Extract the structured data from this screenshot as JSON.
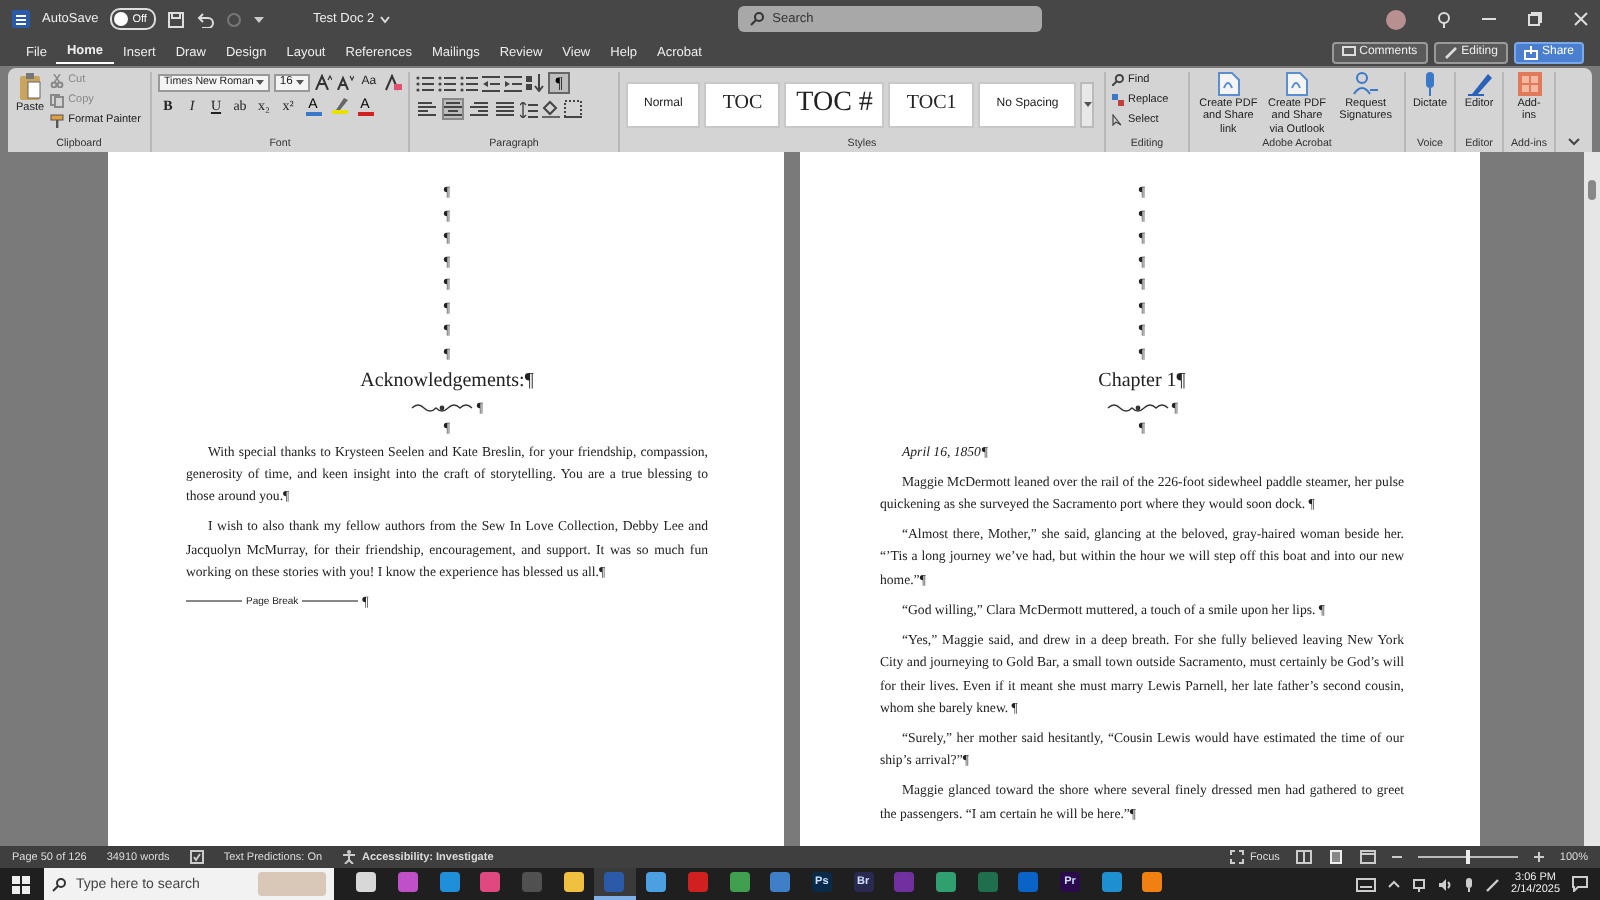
{
  "title_bar": {
    "autosave_label": "AutoSave",
    "autosave": {
      "on": false,
      "label": "Off"
    },
    "document_title": "Test Doc 2",
    "search": {
      "placeholder": "Search"
    }
  },
  "menu_tabs": [
    {
      "label": "File",
      "selected": false
    },
    {
      "label": "Home",
      "selected": true
    },
    {
      "label": "Insert",
      "selected": false
    },
    {
      "label": "Draw",
      "selected": false
    },
    {
      "label": "Design",
      "selected": false
    },
    {
      "label": "Layout",
      "selected": false
    },
    {
      "label": "References",
      "selected": false
    },
    {
      "label": "Mailings",
      "selected": false
    },
    {
      "label": "Review",
      "selected": false
    },
    {
      "label": "View",
      "selected": false
    },
    {
      "label": "Help",
      "selected": false
    },
    {
      "label": "Acrobat",
      "selected": false
    }
  ],
  "header_buttons": [
    {
      "label": "Comments",
      "kind": "comments"
    },
    {
      "label": "Editing",
      "kind": "editing"
    },
    {
      "label": "Share",
      "kind": "share"
    }
  ],
  "ribbon": {
    "clipboard": {
      "paste": "Paste",
      "cut": "Cut",
      "copy": "Copy",
      "format_painter": "Format Painter",
      "group_label": "Clipboard"
    },
    "font": {
      "font_name": "Times New Roman",
      "font_size": "16",
      "case_button": "Aa",
      "format_buttons": [
        "B",
        "I",
        "U",
        "ab",
        "x₂",
        "x²"
      ],
      "effect_buttons": [
        {
          "kind": "text",
          "label": "A",
          "color": "#3a78c8"
        },
        {
          "kind": "highlight",
          "color": "#e8e000"
        },
        {
          "kind": "text",
          "label": "A",
          "color": "#d02020"
        }
      ],
      "group_label": "Font"
    },
    "paragraph": {
      "show_marks": {
        "label": "¶",
        "on": true
      },
      "align_buttons": [
        {
          "kind": "left",
          "selected": false
        },
        {
          "kind": "center",
          "selected": true
        },
        {
          "kind": "right",
          "selected": false
        },
        {
          "kind": "justify",
          "selected": false
        }
      ],
      "group_label": "Paragraph"
    },
    "styles": {
      "items": [
        {
          "label": "Normal",
          "kind": "normal"
        },
        {
          "label": "TOC",
          "kind": "heading"
        },
        {
          "label": "TOC #",
          "kind": "large"
        },
        {
          "label": "TOC1",
          "kind": "heading"
        },
        {
          "label": "No Spacing",
          "kind": "normal"
        }
      ],
      "group_label": "Styles"
    },
    "editing": {
      "items": [
        {
          "label": "Find",
          "kind": "find"
        },
        {
          "label": "Replace",
          "kind": "replace"
        },
        {
          "label": "Select",
          "kind": "select"
        }
      ],
      "group_label": "Editing"
    },
    "acrobat": {
      "items": [
        "Create PDF and Share link",
        "Create PDF and Share via Outlook",
        "Request Signatures"
      ],
      "group_label": "Adobe Acrobat"
    },
    "voice": {
      "button": "Dictate",
      "group_label": "Voice"
    },
    "editor": {
      "button": "Editor",
      "group_label": "Editor"
    },
    "add_ins": {
      "button": "Add-ins",
      "group_label": "Add-ins"
    }
  },
  "pages": [
    {
      "blank_marks": [
        "¶",
        "¶",
        "¶",
        "¶",
        "¶",
        "¶",
        "¶",
        "¶"
      ],
      "heading": "Acknowledgements:¶",
      "ornament_mark": "¶",
      "spacer_mark": "¶",
      "paragraphs": [
        {
          "kind": "body",
          "text": "With special thanks to Krysteen Seelen and Kate Breslin, for your friendship, compassion, generosity of time, and keen insight into the craft of storytelling. You are a true blessing to those around you.¶"
        },
        {
          "kind": "body",
          "text": "I wish to also thank my fellow authors from the Sew In Love Collection, Debby Lee and Jacquolyn McMurray, for their friendship, encouragement, and support. It was so much fun working on these stories with you! I know the experience has blessed us all.¶"
        }
      ],
      "page_break": {
        "label": "Page Break",
        "mark": "¶"
      }
    },
    {
      "blank_marks": [
        "¶",
        "¶",
        "¶",
        "¶",
        "¶",
        "¶",
        "¶",
        "¶"
      ],
      "heading": "Chapter 1¶",
      "ornament_mark": "¶",
      "spacer_mark": "¶",
      "paragraphs": [
        {
          "kind": "date",
          "text": "April 16, 1850¶"
        },
        {
          "kind": "body",
          "text": "Maggie McDermott leaned over the rail of the 226-foot sidewheel paddle steamer, her pulse quickening as she surveyed the Sacramento port where they would soon dock. ¶"
        },
        {
          "kind": "body",
          "text": "“Almost there, Mother,” she said, glancing at the beloved, gray-haired woman beside her. “’Tis a long journey we’ve had, but within the hour we will step off this boat and into our new home.”¶"
        },
        {
          "kind": "body",
          "text": "“God willing,” Clara McDermott muttered, a touch of a smile upon her lips. ¶"
        },
        {
          "kind": "body",
          "text": "“Yes,” Maggie said, and drew in a deep breath. For she fully believed leaving New York City and journeying to Gold Bar, a small town outside Sacramento, must certainly be God’s will for their lives. Even if it meant she must marry Lewis Parnell, her late father’s second cousin, whom she barely knew. ¶"
        },
        {
          "kind": "body",
          "text": "“Surely,” her mother said hesitantly, “Cousin Lewis would have estimated the time of our ship’s arrival?”¶"
        },
        {
          "kind": "body",
          "text": "Maggie glanced toward the shore where several finely dressed men had gathered to greet the passengers. “I am certain he will be here.”¶"
        }
      ]
    }
  ],
  "status_bar": {
    "page": "Page 50 of 126",
    "words": "34910 words",
    "predictions": "Text Predictions: On",
    "accessibility": "Accessibility: Investigate",
    "focus": "Focus",
    "zoom": {
      "level": 0.5,
      "label": "100%"
    }
  },
  "taskbar": {
    "search": {
      "placeholder": "Type here to search"
    },
    "apps": [
      {
        "color": "#d8d8d8",
        "selected": false
      },
      {
        "color": "#c050c8",
        "selected": false
      },
      {
        "color": "#1e8fd8",
        "selected": false
      },
      {
        "color": "#e04880",
        "selected": false
      },
      {
        "color": "#505050",
        "selected": false
      },
      {
        "color": "#f0c040",
        "selected": false
      },
      {
        "color": "#2b5aa8",
        "selected": true
      },
      {
        "color": "#4aa0e0",
        "selected": false
      },
      {
        "color": "#d02020",
        "selected": false
      },
      {
        "color": "#40a050",
        "selected": false
      },
      {
        "color": "#3f7fc8",
        "selected": false
      },
      {
        "color": "#0a2a4a",
        "label": "Ps",
        "selected": false
      },
      {
        "color": "#2a2a50",
        "label": "Br",
        "selected": false
      },
      {
        "color": "#7030a0",
        "selected": false
      },
      {
        "color": "#30a070",
        "selected": false
      },
      {
        "color": "#1f6f4f",
        "selected": false
      },
      {
        "color": "#0a64c8",
        "selected": false
      },
      {
        "color": "#2a0a4a",
        "label": "Pr",
        "selected": false
      },
      {
        "color": "#1e90d0",
        "selected": false
      },
      {
        "color": "#f08010",
        "selected": false
      }
    ],
    "time": "3:06 PM",
    "date": "2/14/2025"
  }
}
